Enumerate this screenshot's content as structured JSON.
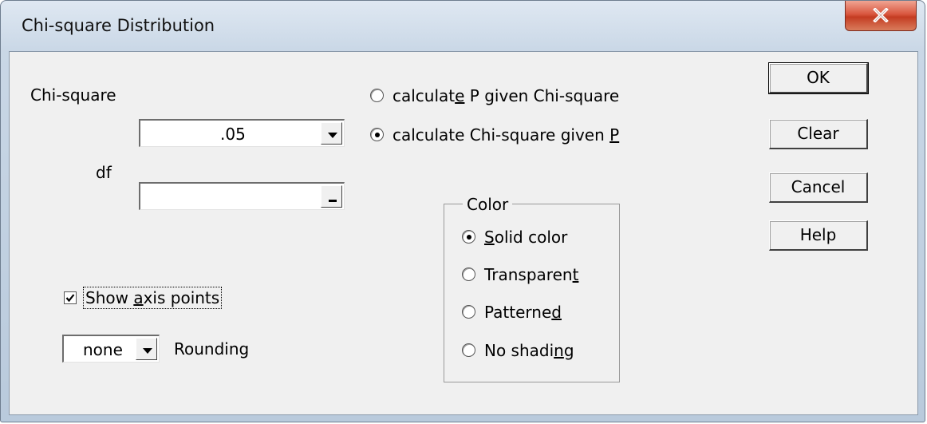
{
  "window": {
    "title": "Chi-square Distribution"
  },
  "icons": {
    "close": "close-x-icon",
    "dropdown": "chevron-down-icon",
    "check": "checkmark-icon"
  },
  "fields": {
    "chi_square_label": "Chi-square",
    "chi_square_value": ".05",
    "df_label": "df",
    "df_value": ""
  },
  "mode": {
    "options": [
      {
        "label_pre": "calculat",
        "label_u": "e",
        "label_post": " P given Chi-square",
        "selected": false
      },
      {
        "label_pre": "calculate Chi-square given ",
        "label_u": "P",
        "label_post": "",
        "selected": true
      }
    ]
  },
  "color_group": {
    "title": "Color",
    "options": [
      {
        "label_pre": "",
        "label_u": "S",
        "label_post": "olid color",
        "selected": true
      },
      {
        "label_pre": "Transparen",
        "label_u": "t",
        "label_post": "",
        "selected": false
      },
      {
        "label_pre": "Patterne",
        "label_u": "d",
        "label_post": "",
        "selected": false
      },
      {
        "label_pre": "No shadi",
        "label_u": "n",
        "label_post": "g",
        "selected": false
      }
    ]
  },
  "axis": {
    "checked": true,
    "label_pre": "Show ",
    "label_u": "a",
    "label_post": "xis points"
  },
  "rounding": {
    "value": "none",
    "label": "Rounding"
  },
  "buttons": {
    "ok": "OK",
    "clear": "Clear",
    "cancel": "Cancel",
    "help": "Help"
  }
}
